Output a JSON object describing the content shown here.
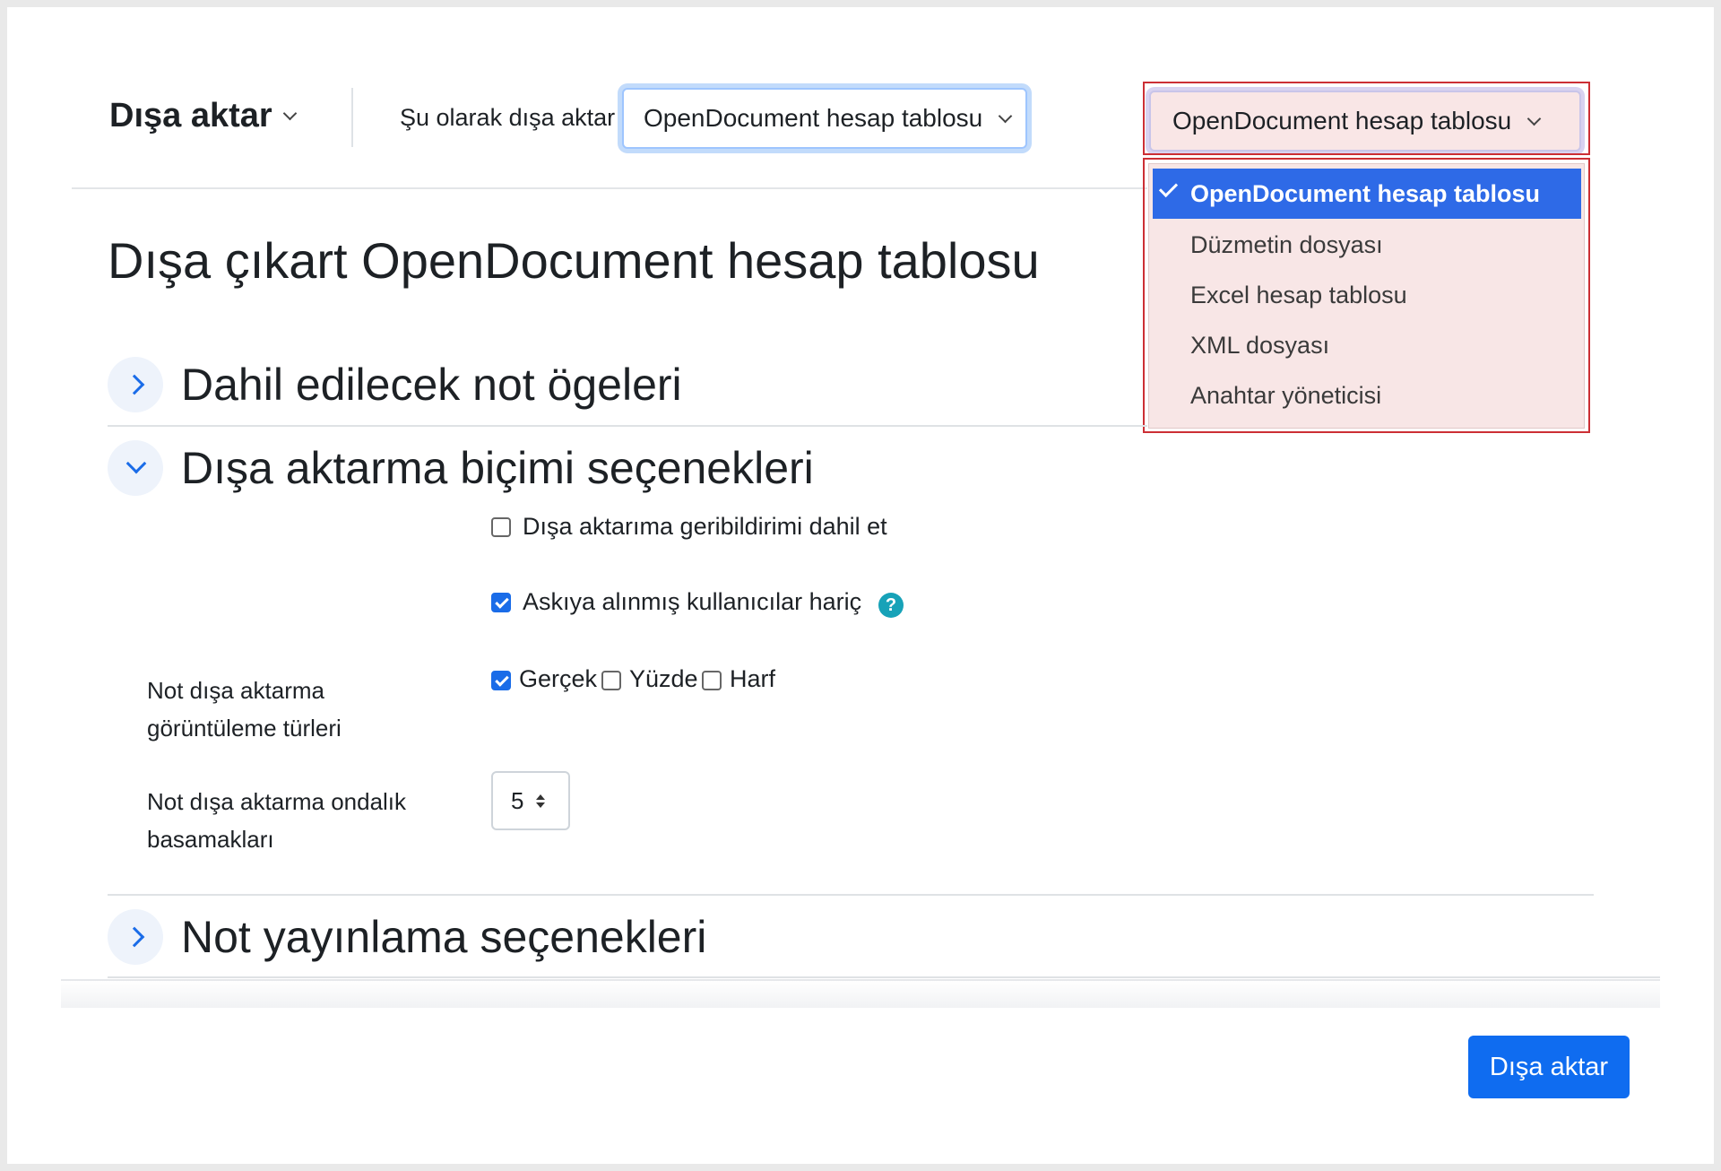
{
  "header": {
    "title": "Dışa aktar",
    "export_as_label": "Şu olarak dışa aktar",
    "format_select_value": "OpenDocument hesap tablosu"
  },
  "dropdown": {
    "value": "OpenDocument hesap tablosu",
    "options": [
      {
        "label": "OpenDocument hesap tablosu",
        "selected": true
      },
      {
        "label": "Düzmetin dosyası",
        "selected": false
      },
      {
        "label": "Excel hesap tablosu",
        "selected": false
      },
      {
        "label": "XML dosyası",
        "selected": false
      },
      {
        "label": "Anahtar yöneticisi",
        "selected": false
      }
    ]
  },
  "page": {
    "title": "Dışa çıkart OpenDocument hesap tablosu"
  },
  "sections": [
    {
      "title": "Dahil edilecek not ögeleri",
      "expanded": false
    },
    {
      "title": "Dışa aktarma biçimi seçenekleri",
      "expanded": true
    },
    {
      "title": "Not yayınlama seçenekleri",
      "expanded": false
    }
  ],
  "options": {
    "include_feedback": {
      "label": "Dışa aktarıma geribildirimi dahil et",
      "checked": false
    },
    "exclude_suspended": {
      "label": "Askıya alınmış kullanıcılar hariç",
      "checked": true
    },
    "help_icon": "?",
    "display_types": {
      "label": "Not dışa aktarma görüntüleme türleri",
      "items": [
        {
          "label": "Gerçek",
          "checked": true
        },
        {
          "label": "Yüzde",
          "checked": false
        },
        {
          "label": "Harf",
          "checked": false
        }
      ]
    },
    "decimal_points": {
      "label": "Not dışa aktarma ondalık basamakları",
      "value": "5"
    }
  },
  "footer": {
    "export_button": "Dışa aktar"
  },
  "colors": {
    "primary": "#0f6cf0",
    "highlight_border": "#cc2f35",
    "help": "#17a2b8"
  }
}
